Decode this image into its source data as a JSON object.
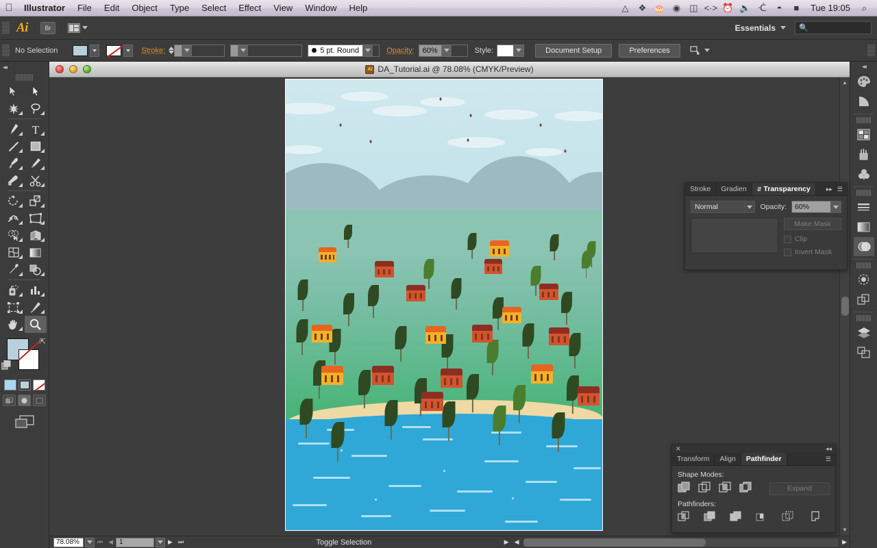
{
  "macbar": {
    "apple": "apple-logo",
    "menus": [
      "Illustrator",
      "File",
      "Edit",
      "Object",
      "Type",
      "Select",
      "Effect",
      "View",
      "Window",
      "Help"
    ],
    "status_icons": [
      "drive-icon",
      "dropbox-icon",
      "evernote-icon",
      "disc-icon",
      "battery-meter-icon",
      "code-icon",
      "timemachine-icon",
      "volume-icon",
      "bluetooth-icon",
      "wifi-icon",
      "power-icon"
    ],
    "clock": "Tue 19:05",
    "spotlight": "search-icon"
  },
  "appbar": {
    "logo": "Ai",
    "bridge": "Br",
    "arrange_docs": "arrange-documents",
    "workspace": "Essentials",
    "search_placeholder": ""
  },
  "controlbar": {
    "selection_status": "No Selection",
    "fill_swatch": "fill-swatch",
    "stroke_swatch": "stroke-none-swatch",
    "stroke_label": "Stroke:",
    "stroke_weight": "",
    "variable_width": "",
    "brush": "5 pt. Round",
    "opacity_label": "Opacity:",
    "opacity_value": "60%",
    "style_label": "Style:",
    "document_setup": "Document Setup",
    "preferences": "Preferences"
  },
  "tools": [
    {
      "name": "selection-tool",
      "glyph": "arrow"
    },
    {
      "name": "direct-selection-tool",
      "glyph": "arrow-white"
    },
    {
      "name": "magic-wand-tool",
      "glyph": "wand"
    },
    {
      "name": "lasso-tool",
      "glyph": "lasso"
    },
    {
      "name": "pen-tool",
      "glyph": "pen"
    },
    {
      "name": "type-tool",
      "glyph": "T"
    },
    {
      "name": "line-segment-tool",
      "glyph": "line"
    },
    {
      "name": "rectangle-tool",
      "glyph": "rect"
    },
    {
      "name": "paintbrush-tool",
      "glyph": "brush"
    },
    {
      "name": "pencil-tool",
      "glyph": "pencil"
    },
    {
      "name": "blob-brush-tool",
      "glyph": "blob"
    },
    {
      "name": "eraser-scissors-tool",
      "glyph": "scissors"
    },
    {
      "name": "rotate-tool",
      "glyph": "rotate"
    },
    {
      "name": "scale-tool",
      "glyph": "scale"
    },
    {
      "name": "width-tool",
      "glyph": "width"
    },
    {
      "name": "free-transform-tool",
      "glyph": "transform"
    },
    {
      "name": "shape-builder-tool",
      "glyph": "shapebuilder"
    },
    {
      "name": "perspective-grid-tool",
      "glyph": "perspective"
    },
    {
      "name": "mesh-tool",
      "glyph": "mesh"
    },
    {
      "name": "gradient-tool",
      "glyph": "gradient"
    },
    {
      "name": "eyedropper-tool",
      "glyph": "eyedropper"
    },
    {
      "name": "blend-tool",
      "glyph": "blend"
    },
    {
      "name": "symbol-sprayer-tool",
      "glyph": "sprayer"
    },
    {
      "name": "column-graph-tool",
      "glyph": "graph"
    },
    {
      "name": "artboard-tool",
      "glyph": "artboard"
    },
    {
      "name": "slice-tool",
      "glyph": "slice"
    },
    {
      "name": "hand-tool",
      "glyph": "hand"
    },
    {
      "name": "zoom-tool",
      "glyph": "zoom",
      "active": true
    }
  ],
  "document": {
    "title": "DA_Tutorial.ai @ 78.08% (CMYK/Preview)",
    "filename": "DA_Tutorial.ai",
    "zoom": "78.08%",
    "color_mode": "CMYK/Preview"
  },
  "statusbar": {
    "zoom": "78.08%",
    "artboard": "1",
    "status": "Toggle Selection"
  },
  "transparency_panel": {
    "tabs": [
      "Stroke",
      "Gradien",
      "Transparency"
    ],
    "active_tab": "Transparency",
    "blend_mode": "Normal",
    "opacity_label": "Opacity:",
    "opacity_value": "60%",
    "make_mask": "Make Mask",
    "clip": "Clip",
    "invert_mask": "Invert Mask"
  },
  "pathfinder_panel": {
    "tabs": [
      "Transform",
      "Align",
      "Pathfinder"
    ],
    "active_tab": "Pathfinder",
    "shape_modes_label": "Shape Modes:",
    "shape_modes": [
      "unite",
      "minus-front",
      "intersect",
      "exclude"
    ],
    "expand": "Expand",
    "pathfinders_label": "Pathfinders:",
    "pathfinders": [
      "divide",
      "trim",
      "merge",
      "crop",
      "outline",
      "minus-back"
    ]
  },
  "dock": [
    {
      "name": "color-panel-icon"
    },
    {
      "name": "color-guide-panel-icon"
    },
    {
      "name": "swatches-panel-icon"
    },
    {
      "name": "brushes-panel-icon"
    },
    {
      "name": "symbols-panel-icon"
    },
    {
      "name": "stroke-panel-icon"
    },
    {
      "name": "gradient-panel-icon"
    },
    {
      "name": "transparency-panel-icon",
      "active": true
    },
    {
      "name": "appearance-panel-icon"
    },
    {
      "name": "graphic-styles-panel-icon"
    },
    {
      "name": "layers-panel-icon"
    },
    {
      "name": "artboards-panel-icon"
    }
  ],
  "artwork": {
    "description": "Flat vector landscape illustration",
    "colors": {
      "sky": "#c4e3ea",
      "cloud": "#e6f3f6",
      "hill": "#9dbac3",
      "ground_near_hill": "#8cc4b4",
      "ground_mid": "#5cb88a",
      "ground_far": "#43b271",
      "beach": "#efd9a4",
      "water": "#2fa8d8",
      "wave": "#bfe6f5",
      "tree_dark": "#2f4a22",
      "tree_mid": "#3d5c2a",
      "tree_light": "#5f9b3d",
      "trunk": "#6e6b4a",
      "house_orange_roof": "#e8651f",
      "house_yellow_body": "#f2b227",
      "house_red_roof": "#8c2f22",
      "house_red_body": "#d4522f",
      "bird": "#6b4a35"
    }
  }
}
